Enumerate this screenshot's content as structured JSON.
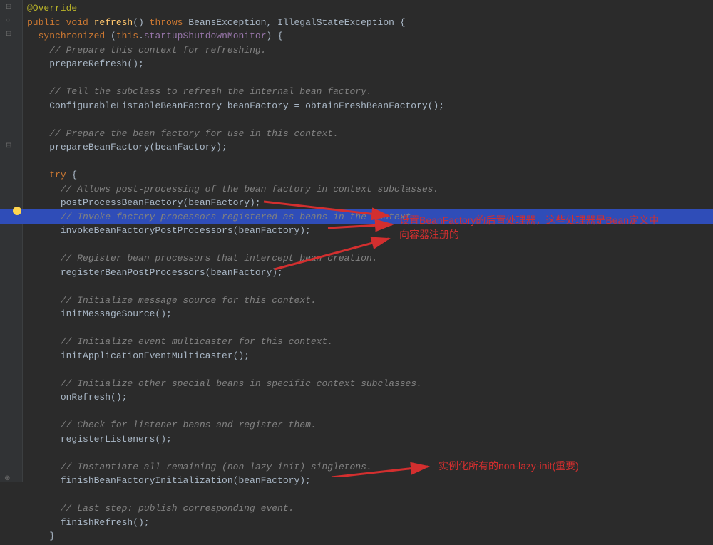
{
  "code": {
    "annotation": "@Override",
    "sig_kw1": "public void",
    "sig_method": " refresh",
    "sig_after": "() ",
    "sig_throws": "throws",
    "sig_ex": " BeansException, IllegalStateException {",
    "sync_kw": "synchronized",
    "sync_open": " (",
    "sync_this": "this",
    "sync_dot": ".",
    "sync_field": "startupShutdownMonitor",
    "sync_close": ") {",
    "c1": "// Prepare this context for refreshing.",
    "l1": "prepareRefresh();",
    "c2": "// Tell the subclass to refresh the internal bean factory.",
    "l2": "ConfigurableListableBeanFactory beanFactory = obtainFreshBeanFactory();",
    "c3": "// Prepare the bean factory for use in this context.",
    "l3": "prepareBeanFactory(beanFactory);",
    "try_kw": "try",
    "try_open": " {",
    "c4": "// Allows post-processing of the bean factory in context subclasses.",
    "l4": "postProcessBeanFactory(beanFactory);",
    "c5a": "// Invoke factory processors registered as beans ",
    "c5b": "in the context.",
    "l5": "invokeBeanFactoryPostProcessors(beanFactory);",
    "c6": "// Register bean processors that intercept bean creation.",
    "l6": "registerBeanPostProcessors(beanFactory);",
    "c7": "// Initialize message source for this context.",
    "l7": "initMessageSource();",
    "c8": "// Initialize event multicaster for this context.",
    "l8": "initApplicationEventMulticaster();",
    "c9": "// Initialize other special beans in specific context subclasses.",
    "l9": "onRefresh();",
    "c10": "// Check for listener beans and register them.",
    "l10": "registerListeners();",
    "c11": "// Instantiate all remaining (non-lazy-init) singletons.",
    "l11": "finishBeanFactoryInitialization(beanFactory);",
    "c12": "// Last step: publish corresponding event.",
    "l12": "finishRefresh();",
    "close": "}"
  },
  "annotations": {
    "a1_line1": "设置BeanFactory的后置处理器，这些处理器是Bean定义中",
    "a1_line2": "向容器注册的",
    "a2": "实例化所有的non-lazy-init(重要)"
  }
}
